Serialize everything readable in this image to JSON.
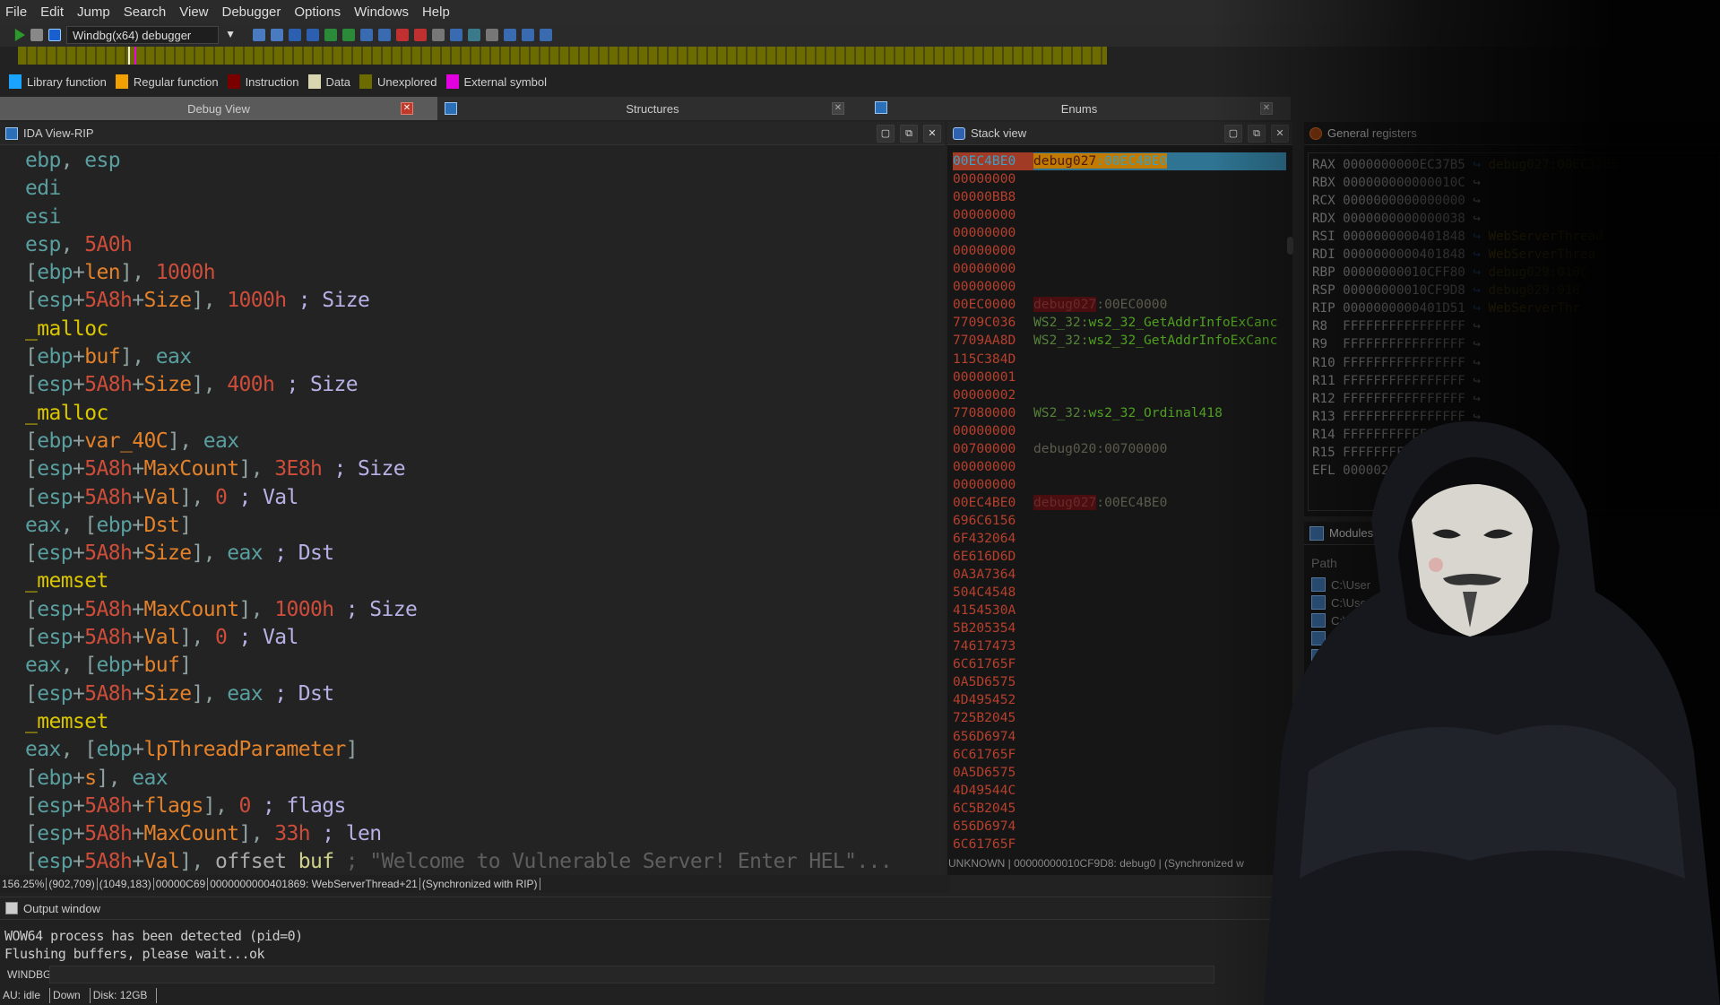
{
  "menu": [
    "File",
    "Edit",
    "Jump",
    "Search",
    "View",
    "Debugger",
    "Options",
    "Windows",
    "Help"
  ],
  "toolbar": {
    "debugger_select": "Windbg(x64) debugger"
  },
  "legend": [
    {
      "label": "Library function",
      "color": "#1aa3ff"
    },
    {
      "label": "Regular function",
      "color": "#f0a000"
    },
    {
      "label": "Instruction",
      "color": "#7a0000"
    },
    {
      "label": "Data",
      "color": "#d8d6b0"
    },
    {
      "label": "Unexplored",
      "color": "#6b6b00"
    },
    {
      "label": "External symbol",
      "color": "#e000e0"
    }
  ],
  "tabs": [
    {
      "label": "Debug View",
      "active": true
    },
    {
      "label": "Structures"
    },
    {
      "label": "Enums"
    }
  ],
  "ida": {
    "title": "IDA View-RIP",
    "lines": [
      [
        [
          "reg",
          "ebp"
        ],
        [
          "pun",
          ", "
        ],
        [
          "reg",
          "esp"
        ]
      ],
      [
        [
          "reg",
          "edi"
        ]
      ],
      [
        [
          "reg",
          "esi"
        ]
      ],
      [
        [
          "reg",
          "esp"
        ],
        [
          "pun",
          ", "
        ],
        [
          "num",
          "5A0h"
        ]
      ],
      [
        [
          "pun",
          "["
        ],
        [
          "reg",
          "ebp"
        ],
        [
          "pun",
          "+"
        ],
        [
          "var",
          "len"
        ],
        [
          "pun",
          "], "
        ],
        [
          "num",
          "1000h"
        ]
      ],
      [
        [
          "pun",
          "["
        ],
        [
          "reg",
          "esp"
        ],
        [
          "pun",
          "+"
        ],
        [
          "num",
          "5A8h"
        ],
        [
          "pun",
          "+"
        ],
        [
          "var",
          "Size"
        ],
        [
          "pun",
          "], "
        ],
        [
          "num",
          "1000h"
        ],
        [
          "cmt",
          " ; Size"
        ]
      ],
      [
        [
          "fn",
          "_malloc"
        ]
      ],
      [
        [
          "pun",
          "["
        ],
        [
          "reg",
          "ebp"
        ],
        [
          "pun",
          "+"
        ],
        [
          "var",
          "buf"
        ],
        [
          "pun",
          "], "
        ],
        [
          "reg",
          "eax"
        ]
      ],
      [
        [
          "pun",
          "["
        ],
        [
          "reg",
          "esp"
        ],
        [
          "pun",
          "+"
        ],
        [
          "num",
          "5A8h"
        ],
        [
          "pun",
          "+"
        ],
        [
          "var",
          "Size"
        ],
        [
          "pun",
          "], "
        ],
        [
          "num",
          "400h"
        ],
        [
          "cmt",
          " ; Size"
        ]
      ],
      [
        [
          "fn",
          "_malloc"
        ]
      ],
      [
        [
          "pun",
          "["
        ],
        [
          "reg",
          "ebp"
        ],
        [
          "pun",
          "+"
        ],
        [
          "var",
          "var_40C"
        ],
        [
          "pun",
          "], "
        ],
        [
          "reg",
          "eax"
        ]
      ],
      [
        [
          "pun",
          "["
        ],
        [
          "reg",
          "esp"
        ],
        [
          "pun",
          "+"
        ],
        [
          "num",
          "5A8h"
        ],
        [
          "pun",
          "+"
        ],
        [
          "var",
          "MaxCount"
        ],
        [
          "pun",
          "], "
        ],
        [
          "num",
          "3E8h"
        ],
        [
          "cmt",
          " ; Size"
        ]
      ],
      [
        [
          "pun",
          "["
        ],
        [
          "reg",
          "esp"
        ],
        [
          "pun",
          "+"
        ],
        [
          "num",
          "5A8h"
        ],
        [
          "pun",
          "+"
        ],
        [
          "var",
          "Val"
        ],
        [
          "pun",
          "], "
        ],
        [
          "num",
          "0"
        ],
        [
          "cmt",
          " ; Val"
        ]
      ],
      [
        [
          "reg",
          "eax"
        ],
        [
          "pun",
          ", ["
        ],
        [
          "reg",
          "ebp"
        ],
        [
          "pun",
          "+"
        ],
        [
          "var",
          "Dst"
        ],
        [
          "pun",
          "]"
        ]
      ],
      [
        [
          "pun",
          "["
        ],
        [
          "reg",
          "esp"
        ],
        [
          "pun",
          "+"
        ],
        [
          "num",
          "5A8h"
        ],
        [
          "pun",
          "+"
        ],
        [
          "var",
          "Size"
        ],
        [
          "pun",
          "], "
        ],
        [
          "reg",
          "eax"
        ],
        [
          "cmt",
          " ; Dst"
        ]
      ],
      [
        [
          "fn",
          "_memset"
        ]
      ],
      [
        [
          "pun",
          "["
        ],
        [
          "reg",
          "esp"
        ],
        [
          "pun",
          "+"
        ],
        [
          "num",
          "5A8h"
        ],
        [
          "pun",
          "+"
        ],
        [
          "var",
          "MaxCount"
        ],
        [
          "pun",
          "], "
        ],
        [
          "num",
          "1000h"
        ],
        [
          "cmt",
          " ; Size"
        ]
      ],
      [
        [
          "pun",
          "["
        ],
        [
          "reg",
          "esp"
        ],
        [
          "pun",
          "+"
        ],
        [
          "num",
          "5A8h"
        ],
        [
          "pun",
          "+"
        ],
        [
          "var",
          "Val"
        ],
        [
          "pun",
          "], "
        ],
        [
          "num",
          "0"
        ],
        [
          "cmt",
          " ; Val"
        ]
      ],
      [
        [
          "reg",
          "eax"
        ],
        [
          "pun",
          ", ["
        ],
        [
          "reg",
          "ebp"
        ],
        [
          "pun",
          "+"
        ],
        [
          "var",
          "buf"
        ],
        [
          "pun",
          "]"
        ]
      ],
      [
        [
          "pun",
          "["
        ],
        [
          "reg",
          "esp"
        ],
        [
          "pun",
          "+"
        ],
        [
          "num",
          "5A8h"
        ],
        [
          "pun",
          "+"
        ],
        [
          "var",
          "Size"
        ],
        [
          "pun",
          "], "
        ],
        [
          "reg",
          "eax"
        ],
        [
          "cmt",
          " ; Dst"
        ]
      ],
      [
        [
          "fn",
          "_memset"
        ]
      ],
      [
        [
          "reg",
          "eax"
        ],
        [
          "pun",
          ", ["
        ],
        [
          "reg",
          "ebp"
        ],
        [
          "pun",
          "+"
        ],
        [
          "var",
          "lpThreadParameter"
        ],
        [
          "pun",
          "]"
        ]
      ],
      [
        [
          "pun",
          "["
        ],
        [
          "reg",
          "ebp"
        ],
        [
          "pun",
          "+"
        ],
        [
          "var",
          "s"
        ],
        [
          "pun",
          "], "
        ],
        [
          "reg",
          "eax"
        ]
      ],
      [
        [
          "pun",
          "["
        ],
        [
          "reg",
          "esp"
        ],
        [
          "pun",
          "+"
        ],
        [
          "num",
          "5A8h"
        ],
        [
          "pun",
          "+"
        ],
        [
          "var",
          "flags"
        ],
        [
          "pun",
          "], "
        ],
        [
          "num",
          "0"
        ],
        [
          "cmt",
          " ; flags"
        ]
      ],
      [
        [
          "pun",
          "["
        ],
        [
          "reg",
          "esp"
        ],
        [
          "pun",
          "+"
        ],
        [
          "num",
          "5A8h"
        ],
        [
          "pun",
          "+"
        ],
        [
          "var",
          "MaxCount"
        ],
        [
          "pun",
          "], "
        ],
        [
          "num",
          "33h"
        ],
        [
          "cmt",
          " ; len"
        ]
      ],
      [
        [
          "pun",
          "["
        ],
        [
          "reg",
          "esp"
        ],
        [
          "pun",
          "+"
        ],
        [
          "num",
          "5A8h"
        ],
        [
          "pun",
          "+"
        ],
        [
          "var",
          "Val"
        ],
        [
          "pun",
          "], "
        ],
        [
          "off",
          "offset "
        ],
        [
          "bf",
          "buf"
        ],
        [
          "str",
          " ; \"Welcome to Vulnerable Server! Enter HEL\"..."
        ]
      ]
    ],
    "status": [
      "156.25%",
      "(902,709)",
      "(1049,183)",
      "00000C69",
      "0000000000401869: WebServerThread+21",
      "(Synchronized with RIP)"
    ]
  },
  "stack": {
    "title": "Stack view",
    "rows": [
      {
        "addr": "00EC4BE0",
        "seg": "debug027",
        "rest": ":00EC4BE0",
        "kind": "hl"
      },
      {
        "addr": "00000000"
      },
      {
        "addr": "00000BB8"
      },
      {
        "addr": "00000000"
      },
      {
        "addr": "00000000"
      },
      {
        "addr": "00000000"
      },
      {
        "addr": "00000000"
      },
      {
        "addr": "00000000"
      },
      {
        "addr": "00EC0000",
        "seg": "debug027",
        "rest": ":00EC0000",
        "kind": "dseg"
      },
      {
        "addr": "7709C036",
        "seg": "WS2_32:",
        "rest": "ws2_32_GetAddrInfoExCanc",
        "kind": "ws"
      },
      {
        "addr": "7709AA8D",
        "seg": "WS2_32:",
        "rest": "ws2_32_GetAddrInfoExCanc",
        "kind": "ws"
      },
      {
        "addr": "115C384D"
      },
      {
        "addr": "00000001"
      },
      {
        "addr": "00000002"
      },
      {
        "addr": "77080000",
        "seg": "WS2_32:",
        "rest": "ws2_32_Ordinal418",
        "kind": "ws"
      },
      {
        "addr": "00000000"
      },
      {
        "addr": "00700000",
        "seg": "debug020",
        "rest": ":00700000",
        "kind": "plain"
      },
      {
        "addr": "00000000"
      },
      {
        "addr": "00000000"
      },
      {
        "addr": "00EC4BE0",
        "seg": "debug027",
        "rest": ":00EC4BE0",
        "kind": "dseg"
      },
      {
        "addr": "696C6156"
      },
      {
        "addr": "6F432064"
      },
      {
        "addr": "6E616D6D"
      },
      {
        "addr": "0A3A7364"
      },
      {
        "addr": "504C4548"
      },
      {
        "addr": "4154530A"
      },
      {
        "addr": "5B205354"
      },
      {
        "addr": "74617473"
      },
      {
        "addr": "6C61765F"
      },
      {
        "addr": "0A5D6575"
      },
      {
        "addr": "4D495452"
      },
      {
        "addr": "725B2045"
      },
      {
        "addr": "656D6974"
      },
      {
        "addr": "6C61765F"
      },
      {
        "addr": "0A5D6575"
      },
      {
        "addr": "4D49544C"
      },
      {
        "addr": "6C5B2045"
      },
      {
        "addr": "656D6974"
      },
      {
        "addr": "6C61765F"
      }
    ],
    "footer": "UNKNOWN | 00000000010CF9D8: debug0 | (Synchronized w"
  },
  "registers": {
    "title": "General registers",
    "rows": [
      {
        "name": "RAX",
        "value": "0000000000EC37B5",
        "ref": "debug027:00EC37B5",
        "kind": "rd"
      },
      {
        "name": "RBX",
        "value": "000000000000010C"
      },
      {
        "name": "RCX",
        "value": "0000000000000000"
      },
      {
        "name": "RDX",
        "value": "0000000000000038"
      },
      {
        "name": "RSI",
        "value": "0000000000401848",
        "ref": "WebServerThread",
        "kind": "rw"
      },
      {
        "name": "RDI",
        "value": "0000000000401848",
        "ref": "WebServerThrea",
        "kind": "rw"
      },
      {
        "name": "RBP",
        "value": "00000000010CFF80",
        "ref": "debug029:010C",
        "kind": "rd"
      },
      {
        "name": "RSP",
        "value": "00000000010CF9D8",
        "ref": "debug029:010",
        "kind": "rd"
      },
      {
        "name": "RIP",
        "value": "0000000000401D51",
        "ref": "WebServerThr",
        "kind": "rw"
      },
      {
        "name": "R8 ",
        "value": "FFFFFFFFFFFFFFFF"
      },
      {
        "name": "R9 ",
        "value": "FFFFFFFFFFFFFFFF"
      },
      {
        "name": "R10",
        "value": "FFFFFFFFFFFFFFFF"
      },
      {
        "name": "R11",
        "value": "FFFFFFFFFFFFFFFF"
      },
      {
        "name": "R12",
        "value": "FFFFFFFFFFFFFFFF"
      },
      {
        "name": "R13",
        "value": "FFFFFFFFFFFFFFFF"
      },
      {
        "name": "R14",
        "value": "FFFFFFFFFFFF"
      },
      {
        "name": "R15",
        "value": "FFFFFFFF"
      },
      {
        "name": "EFL",
        "value": "000002"
      }
    ]
  },
  "modules": {
    "title": "Modules",
    "column": "Path",
    "rows": [
      "C:\\User",
      "C:\\User",
      "C:\\Wind",
      "C:\\Wind",
      "C:\\Wi"
    ]
  },
  "output": {
    "title": "Output window",
    "lines": [
      "WOW64 process has been detected (pid=0)",
      "Flushing buffers, please wait...ok"
    ],
    "prompt": "WINDBG"
  },
  "statusbar": [
    "AU:  idle",
    "Down",
    "Disk: 12GB"
  ]
}
